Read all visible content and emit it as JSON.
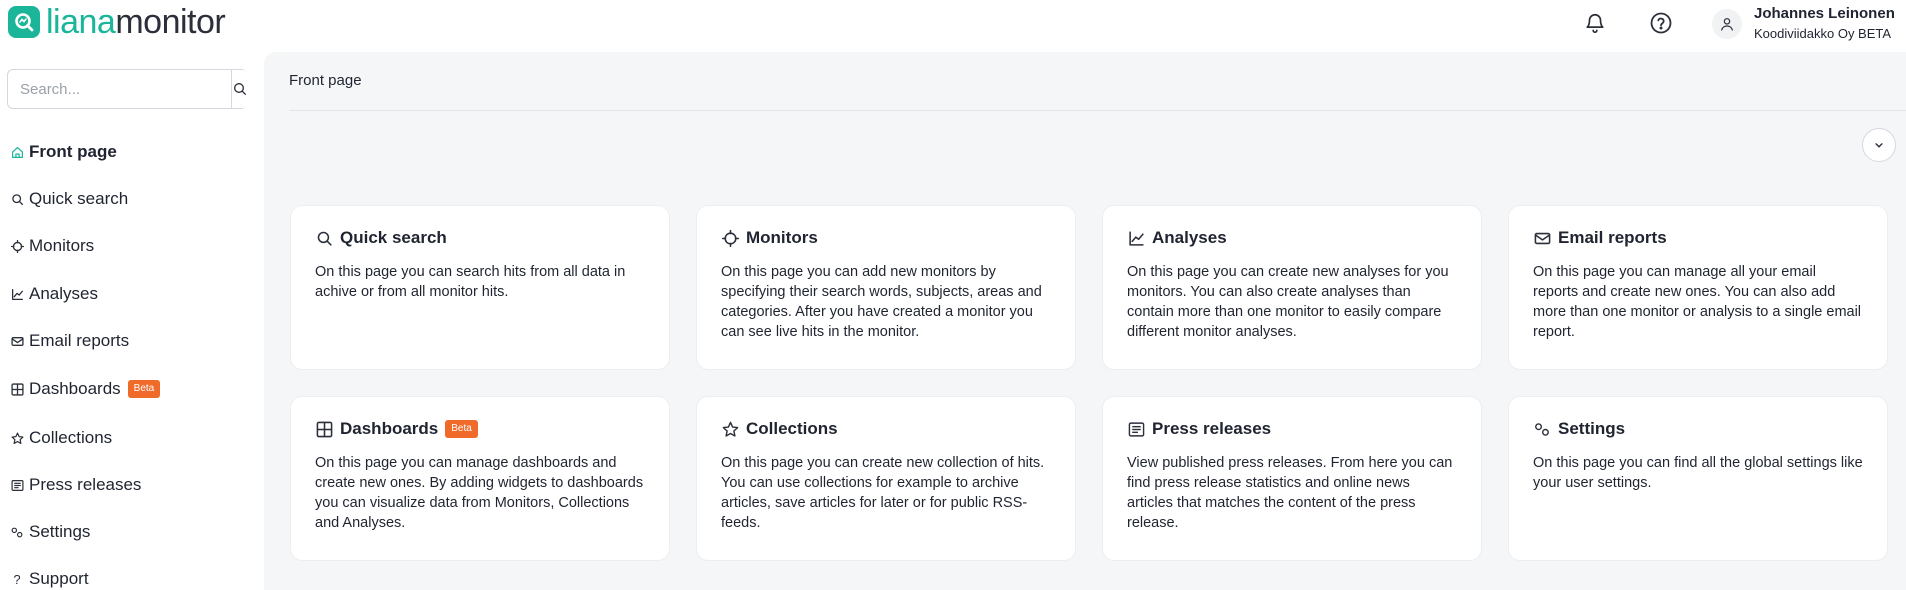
{
  "brand": {
    "part1": "liana",
    "part2": "monitor",
    "accent": "#1bb59a"
  },
  "header": {
    "notifications_icon": "bell-icon",
    "help_icon": "question-circle-icon",
    "user": {
      "name": "Johannes Leinonen",
      "org": "Koodiviidakko Oy BETA"
    }
  },
  "sidebar": {
    "search": {
      "placeholder": "Search...",
      "value": ""
    },
    "items": [
      {
        "label": "Front page",
        "icon": "home-icon",
        "active": true
      },
      {
        "label": "Quick search",
        "icon": "search-icon"
      },
      {
        "label": "Monitors",
        "icon": "crosshair-icon"
      },
      {
        "label": "Analyses",
        "icon": "chart-line-icon"
      },
      {
        "label": "Email reports",
        "icon": "envelope-icon"
      },
      {
        "label": "Dashboards",
        "icon": "grid-icon",
        "badge": "Beta"
      },
      {
        "label": "Collections",
        "icon": "star-icon"
      },
      {
        "label": "Press releases",
        "icon": "newspaper-icon"
      },
      {
        "label": "Settings",
        "icon": "gears-icon"
      },
      {
        "label": "Support",
        "icon": "question-icon"
      }
    ]
  },
  "main": {
    "breadcrumb": "Front page",
    "cards": [
      {
        "title": "Quick search",
        "icon": "search-icon",
        "desc": "On this page you can search hits from all data in achive or from all monitor hits."
      },
      {
        "title": "Monitors",
        "icon": "crosshair-icon",
        "desc": "On this page you can add new monitors by specifying their search words, subjects, areas and categories. After you have created a monitor you can see live hits in the monitor."
      },
      {
        "title": "Analyses",
        "icon": "chart-line-icon",
        "desc": "On this page you can create new analyses for you monitors. You can also create analyses than contain more than one monitor to easily compare different monitor analyses."
      },
      {
        "title": "Email reports",
        "icon": "envelope-icon",
        "desc": "On this page you can manage all your email reports and create new ones. You can also add more than one monitor or analysis to a single email report."
      },
      {
        "title": "Dashboards",
        "icon": "grid-icon",
        "badge": "Beta",
        "desc": "On this page you can manage dashboards and create new ones. By adding widgets to dashboards you can visualize data from Monitors, Collections and Analyses."
      },
      {
        "title": "Collections",
        "icon": "star-icon",
        "desc": "On this page you can create new collection of hits. You can use collections for example to archive articles, save articles for later or for public RSS-feeds."
      },
      {
        "title": "Press releases",
        "icon": "newspaper-icon",
        "desc": "View published press releases. From here you can find press release statistics and online news articles that matches the content of the press release."
      },
      {
        "title": "Settings",
        "icon": "gears-icon",
        "desc": "On this page you can find all the global settings like your user settings."
      }
    ]
  },
  "colors": {
    "beta_badge": "#f06a2a",
    "background": "#f5f6f8"
  }
}
